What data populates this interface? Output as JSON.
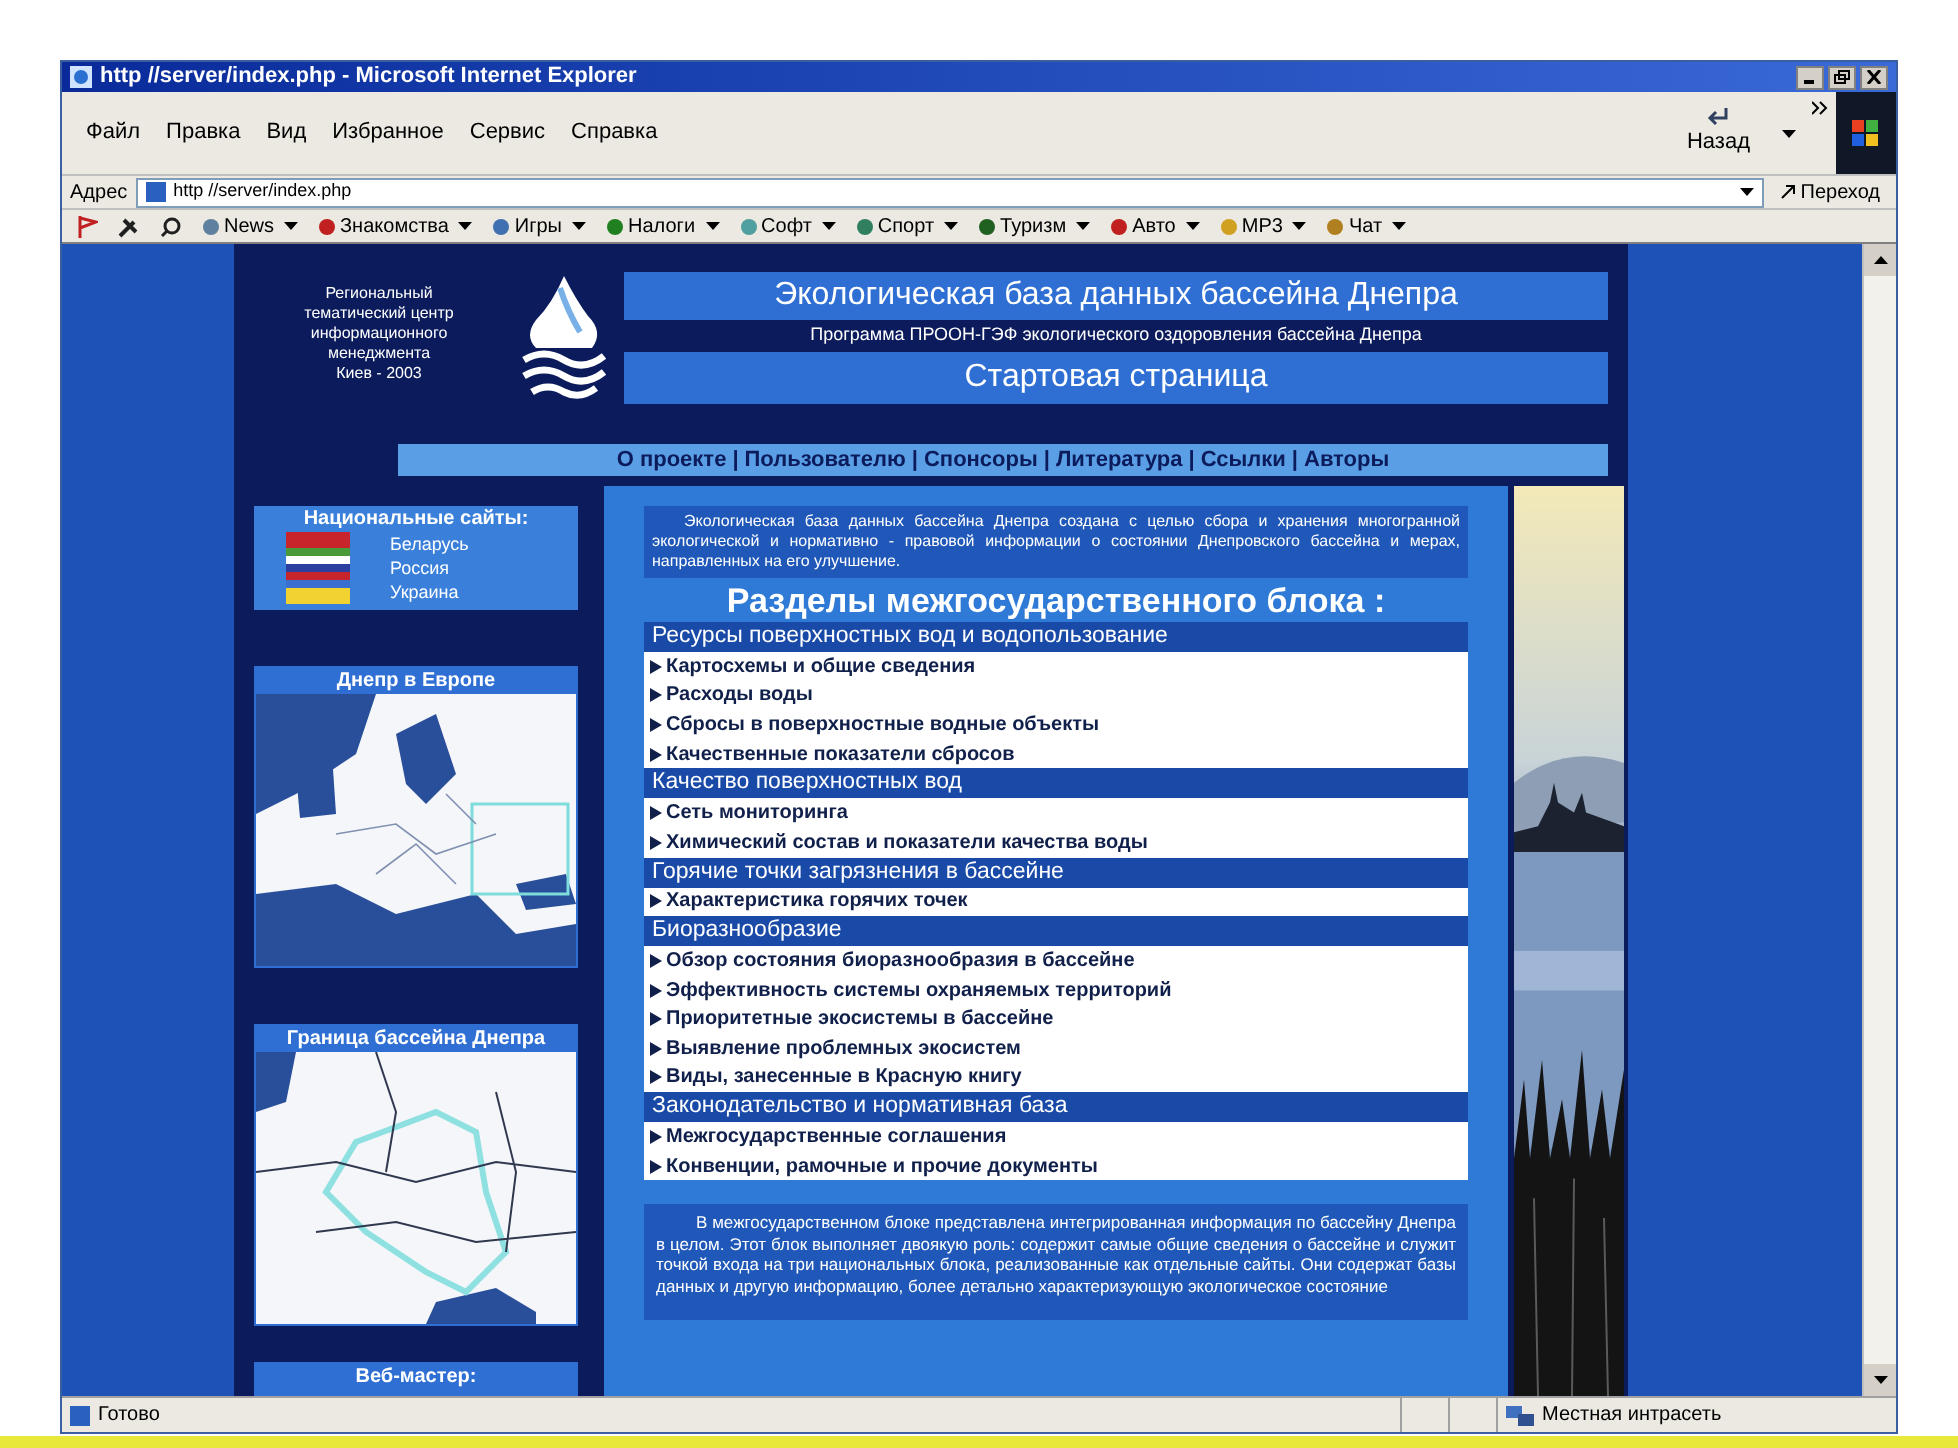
{
  "window": {
    "title": "http //server/index.php - Microsoft Internet Explorer"
  },
  "menu": [
    "Файл",
    "Правка",
    "Вид",
    "Избранное",
    "Сервис",
    "Справка"
  ],
  "back_button": {
    "label": "Назад"
  },
  "address_bar": {
    "label": "Адрес",
    "value": "http //server/index.php",
    "go_button": "Переход"
  },
  "links_bar": [
    "News",
    "Знакомства",
    "Игры",
    "Налоги",
    "Софт",
    "Спорт",
    "Туризм",
    "Авто",
    "MP3",
    "Чат"
  ],
  "page": {
    "logo_text": "Региональный\nтематический центр\nинформационного\nменеджмента\nКиев - 2003",
    "title": "Экологическая база данных бассейна Днепра",
    "subtitle": "Программа ПРООН-ГЭФ экологического оздоровления бассейна Днепра",
    "heading": "Стартовая страница",
    "nav": {
      "separator": "|",
      "items": [
        "О проекте",
        "Пользователю",
        "Спонсоры",
        "Литература",
        "Ссылки",
        "Авторы"
      ]
    },
    "national_sites": {
      "title": "Национальные сайты:",
      "items": [
        {
          "label": "Беларусь"
        },
        {
          "label": "Россия"
        },
        {
          "label": "Украина"
        }
      ]
    },
    "maps": [
      {
        "title": "Днепр в Европе",
        "kind": "picture"
      },
      {
        "title": "Граница бассейна Днепра",
        "kind": "picture"
      }
    ],
    "webmaster": {
      "title": "Веб-мастер:"
    },
    "intro": "Экологическая база данных бассейна Днепра создана с целью сбора и хранения многогранной экологической и нормативно - правовой информации о состоянии Днепровского бассейна и мерах, направленных на его улучшение.",
    "sections_title": "Разделы межгосударственного блока :",
    "sections": [
      {
        "title": "Ресурсы поверхностных вод и водопользование",
        "items": [
          "Картосхемы и общие сведения",
          "Расходы воды",
          "Сбросы в поверхностные водные объекты",
          "Качественные показатели сбросов"
        ]
      },
      {
        "title": "Качество поверхностных вод",
        "items": [
          "Сеть мониторинга",
          "Химический состав и показатели качества воды"
        ]
      },
      {
        "title": "Горячие точки загрязнения в бассейне",
        "items": [
          "Характеристика горячих точек"
        ]
      },
      {
        "title": "Биоразнообразие",
        "items": [
          "Обзор состояния биоразнообразия в бассейне",
          "Эффективность системы охраняемых территорий",
          "Приоритетные экосистемы в бассейне",
          "Выявление проблемных экосистем",
          "Виды, занесенные в Красную книгу"
        ]
      },
      {
        "title": "Законодательство и нормативная база",
        "items": [
          "Межгосударственные соглашения",
          "Конвенции, рамочные и прочие документы"
        ]
      }
    ],
    "outro": "В межгосударственном блоке представлена интегрированная информация по бассейну Днепра в целом. Этот блок выполняет двоякую роль: содержит самые общие сведения о бассейне и служит точкой входа на три национальных блока, реализованные как отдельные сайты. Они содержат базы данных и другую информацию, более детально характеризующую экологическое состояние"
  },
  "status_bar": {
    "text": "Готово",
    "zone": "Местная интрасеть"
  }
}
